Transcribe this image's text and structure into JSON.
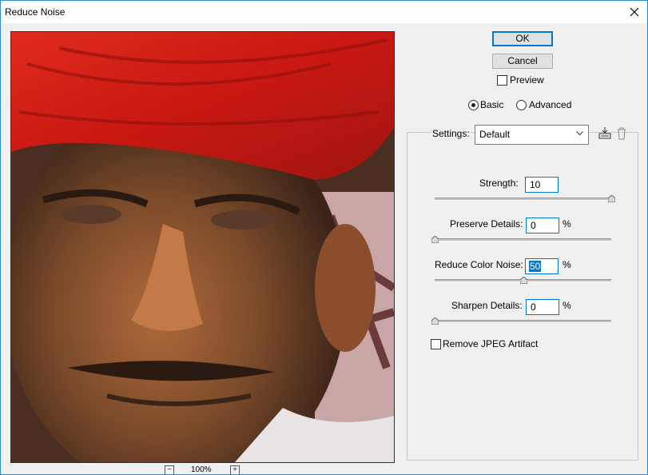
{
  "window": {
    "title": "Reduce Noise"
  },
  "preview": {
    "zoom": "100%",
    "zoom_out": "−",
    "zoom_in": "+"
  },
  "buttons": {
    "ok": "OK",
    "cancel": "Cancel"
  },
  "preview_checkbox": {
    "label": "Preview",
    "checked": false
  },
  "mode": {
    "options": [
      "Basic",
      "Advanced"
    ],
    "selected": "Basic"
  },
  "settings": {
    "label": "Settings:",
    "value": "Default"
  },
  "strength": {
    "label": "Strength:",
    "value": "10",
    "unit": "",
    "max": 10
  },
  "preserve_details": {
    "label": "Preserve Details:",
    "value": "0",
    "unit": "%",
    "max": 100
  },
  "reduce_color_noise": {
    "label": "Reduce Color Noise:",
    "value": "50",
    "unit": "%",
    "max": 100
  },
  "sharpen_details": {
    "label": "Sharpen Details:",
    "value": "0",
    "unit": "%",
    "max": 100
  },
  "remove_jpeg": {
    "label": "Remove JPEG Artifact",
    "checked": false
  },
  "colors": {
    "accent": "#0078d7",
    "window_bg": "#f0f0f0"
  }
}
